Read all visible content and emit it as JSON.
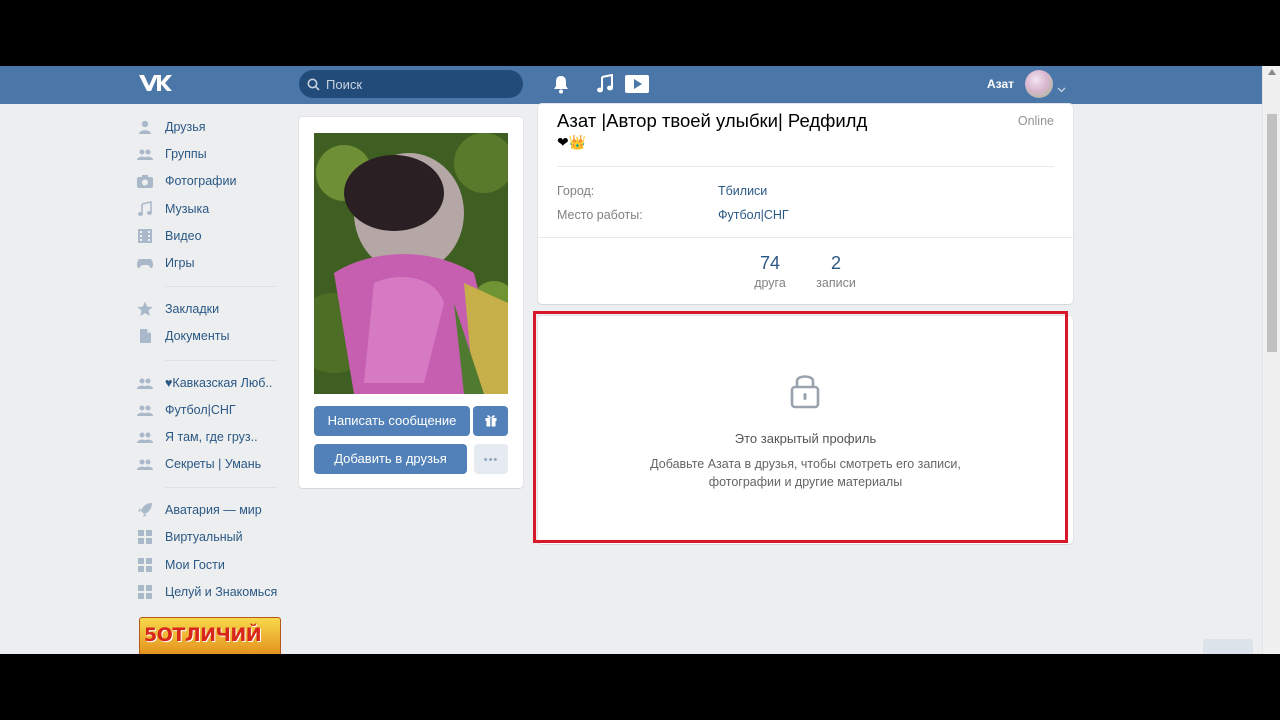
{
  "header": {
    "search_placeholder": "Поиск",
    "user_name": "Азат"
  },
  "sidebar": {
    "main": [
      {
        "label": "Друзья",
        "icon": "person-icon"
      },
      {
        "label": "Группы",
        "icon": "people-icon"
      },
      {
        "label": "Фотографии",
        "icon": "camera-icon"
      },
      {
        "label": "Музыка",
        "icon": "music-note-icon"
      },
      {
        "label": "Видео",
        "icon": "film-icon"
      },
      {
        "label": "Игры",
        "icon": "gamepad-icon"
      }
    ],
    "secondary": [
      {
        "label": "Закладки",
        "icon": "star-icon"
      },
      {
        "label": "Документы",
        "icon": "document-icon"
      }
    ],
    "groups": [
      {
        "label": "♥Кавказская Люб..",
        "icon": "people-icon"
      },
      {
        "label": "Футбол|СНГ",
        "icon": "people-icon"
      },
      {
        "label": "Я там, где груз..",
        "icon": "people-icon"
      },
      {
        "label": "Секреты | Умань",
        "icon": "people-icon"
      }
    ],
    "apps": [
      {
        "label": "Аватария — мир",
        "icon": "rocket-icon"
      },
      {
        "label": "Виртуальный",
        "icon": "apps-grid-icon"
      },
      {
        "label": "Мои Гости",
        "icon": "apps-grid-icon"
      },
      {
        "label": "Целуй и Знакомься",
        "icon": "apps-grid-icon"
      }
    ],
    "banner_text": "5ОТЛИЧИЙ"
  },
  "profile": {
    "name": "Азат |Автор твоей улыбки| Редфилд",
    "status_emoji": "❤👑",
    "online": "Online",
    "info": [
      {
        "label": "Город:",
        "value": "Тбилиси"
      },
      {
        "label": "Место работы:",
        "value": "Футбол|СНГ"
      }
    ],
    "stats": [
      {
        "value": "74",
        "caption": "друга"
      },
      {
        "value": "2",
        "caption": "записи"
      }
    ],
    "buttons": {
      "message": "Написать сообщение",
      "add_friend": "Добавить в друзья",
      "more": "•••"
    }
  },
  "private_profile": {
    "title": "Это закрытый профиль",
    "description": "Добавьте Азата в друзья, чтобы смотреть его записи, фотографии и другие материалы"
  },
  "colors": {
    "header": "#4a76a8",
    "link": "#2a5885",
    "button": "#5181b8",
    "highlight": "#d8182a"
  }
}
